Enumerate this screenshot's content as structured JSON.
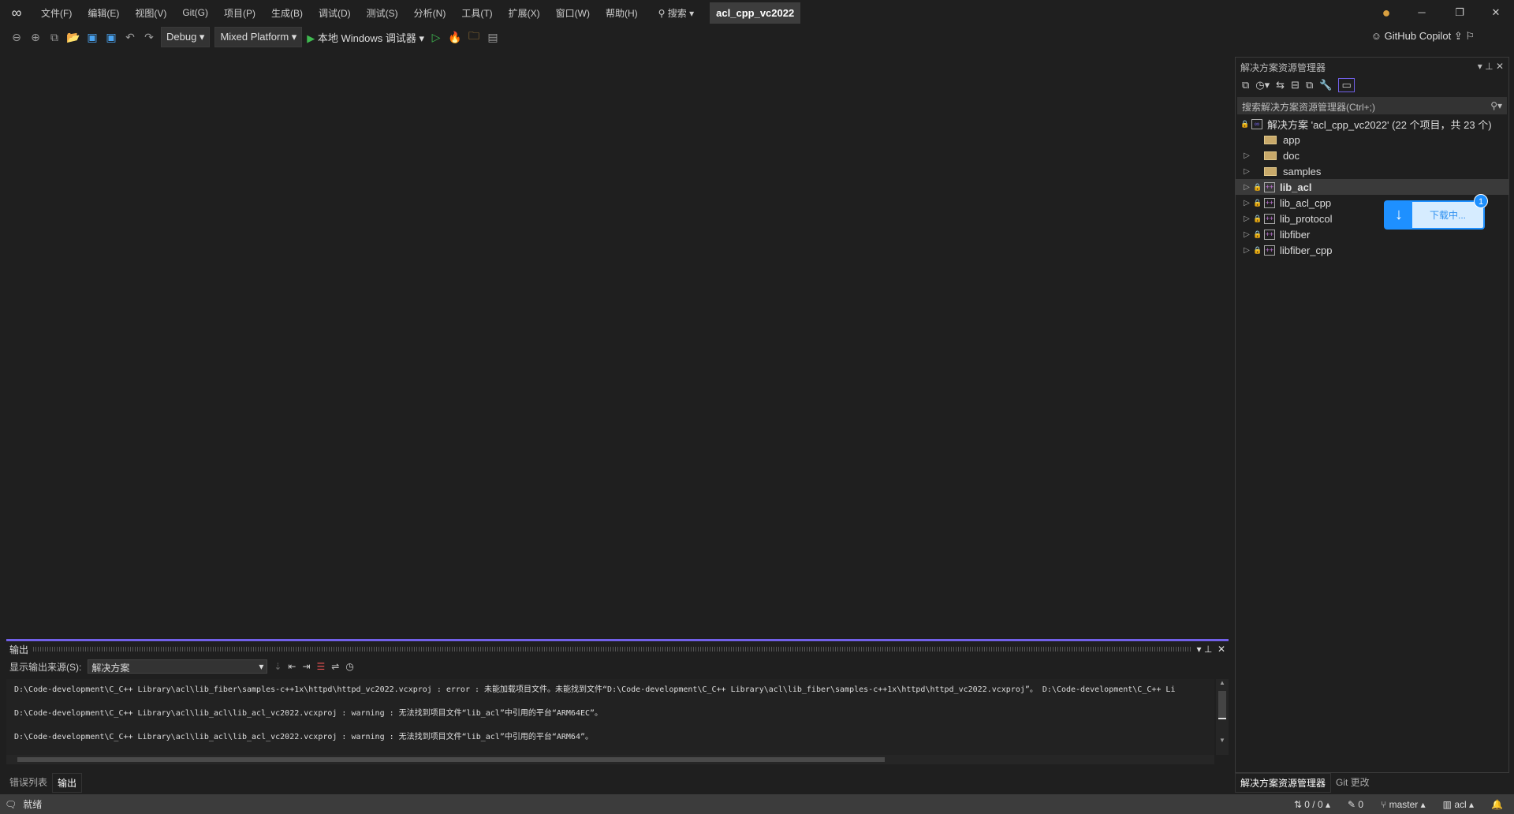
{
  "menu": [
    "文件(F)",
    "编辑(E)",
    "视图(V)",
    "Git(G)",
    "项目(P)",
    "生成(B)",
    "调试(D)",
    "测试(S)",
    "分析(N)",
    "工具(T)",
    "扩展(X)",
    "窗口(W)",
    "帮助(H)"
  ],
  "search_label": "搜索",
  "solution_title": "acl_cpp_vc2022",
  "toolbar": {
    "config": "Debug",
    "platform": "Mixed Platform",
    "run": "本地 Windows 调试器"
  },
  "copilot": "GitHub Copilot",
  "solution_explorer": {
    "title": "解决方案资源管理器",
    "search_placeholder": "搜索解决方案资源管理器(Ctrl+;)",
    "root": "解决方案 'acl_cpp_vc2022' (22 个项目，共 23 个)",
    "items": [
      {
        "label": "app",
        "type": "folder"
      },
      {
        "label": "doc",
        "type": "folder"
      },
      {
        "label": "samples",
        "type": "folder"
      },
      {
        "label": "lib_acl",
        "type": "project"
      },
      {
        "label": "lib_acl_cpp",
        "type": "project"
      },
      {
        "label": "lib_protocol",
        "type": "project"
      },
      {
        "label": "libfiber",
        "type": "project"
      },
      {
        "label": "libfiber_cpp",
        "type": "project"
      }
    ]
  },
  "toast": {
    "text": "下载中...",
    "badge": "1"
  },
  "output": {
    "title": "输出",
    "source_label": "显示输出来源(S):",
    "source_value": "解决方案",
    "lines": [
      "D:\\Code-development\\C_C++ Library\\acl\\lib_fiber\\samples-c++1x\\httpd\\httpd_vc2022.vcxproj : error  : 未能加载项目文件。未能找到文件“D:\\Code-development\\C_C++ Library\\acl\\lib_fiber\\samples-c++1x\\httpd\\httpd_vc2022.vcxproj”。  D:\\Code-development\\C_C++ Li",
      "",
      "D:\\Code-development\\C_C++ Library\\acl\\lib_acl\\lib_acl_vc2022.vcxproj : warning  : 无法找到项目文件“lib_acl”中引用的平台“ARM64EC”。",
      "",
      "D:\\Code-development\\C_C++ Library\\acl\\lib_acl\\lib_acl_vc2022.vcxproj : warning  : 无法找到项目文件“lib_acl”中引用的平台“ARM64”。"
    ]
  },
  "bottom_tabs": [
    "错误列表",
    "输出"
  ],
  "right_tabs": [
    "解决方案资源管理器",
    "Git 更改"
  ],
  "status": {
    "ready": "就绪",
    "sync": "0 / 0",
    "edits": "0",
    "branch": "master",
    "repo": "acl"
  }
}
